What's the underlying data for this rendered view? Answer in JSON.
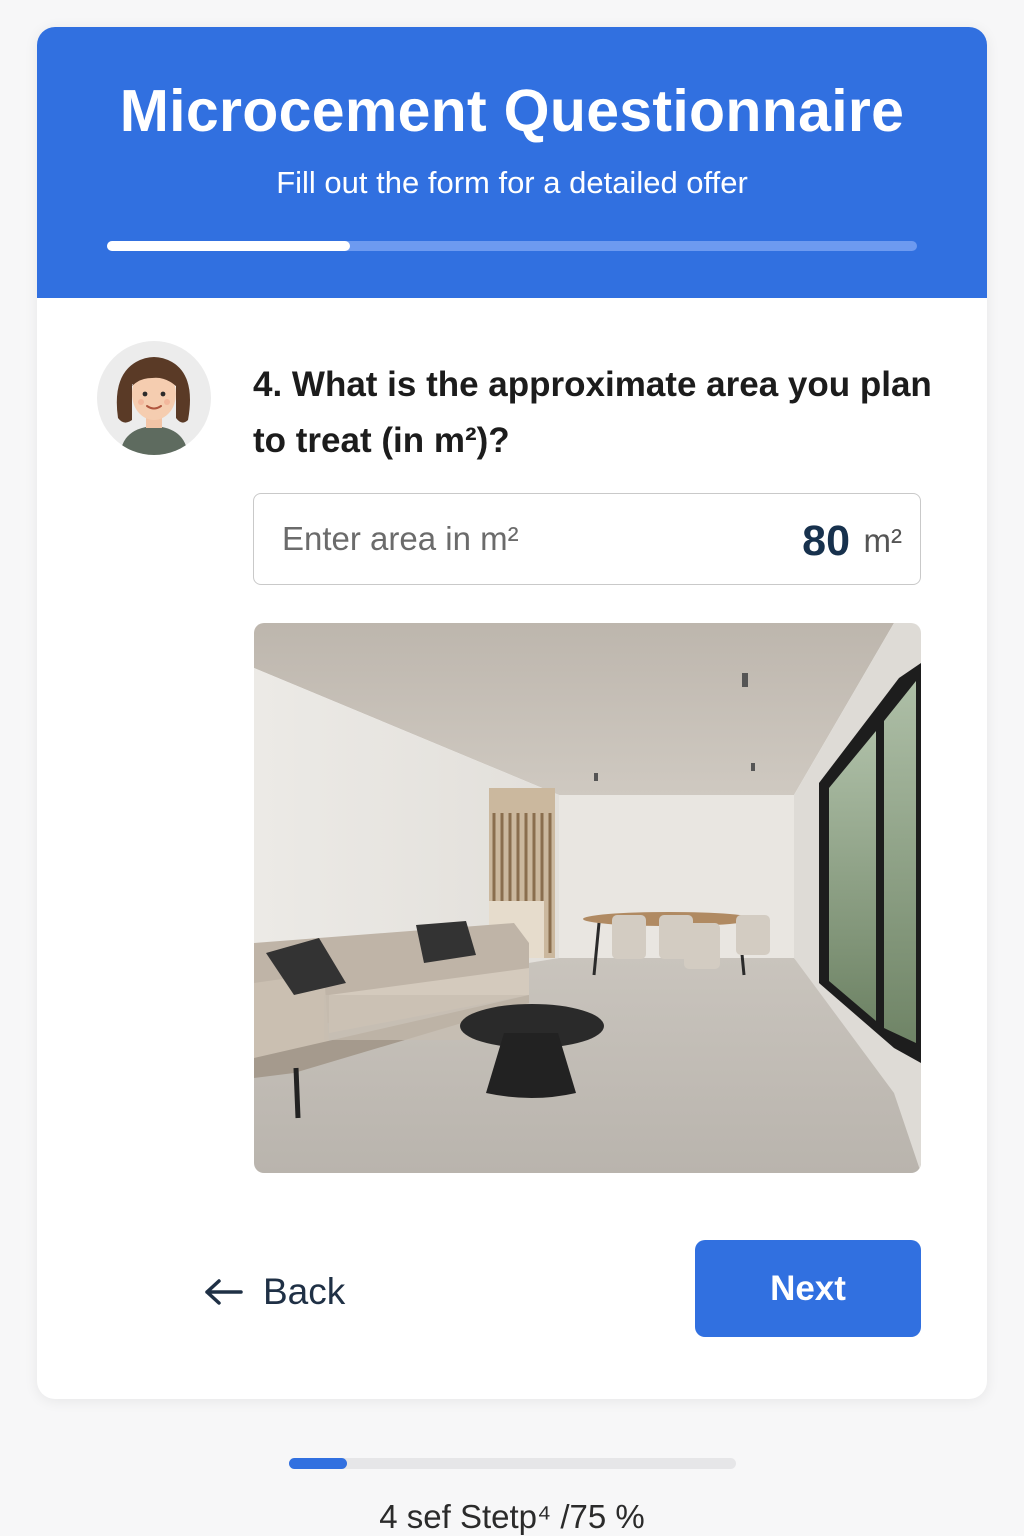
{
  "header": {
    "title": "Microcement Questionnaire",
    "subtitle": "Fill out the form for a detailed offer",
    "progress_fraction": 0.3
  },
  "question": {
    "text": "4. What is the approximate area you plan to treat (in m²)?",
    "avatar_icon": "woman-avatar-icon"
  },
  "area_input": {
    "placeholder": "Enter area in m²",
    "value": "80",
    "unit": "m²"
  },
  "image": {
    "description_icon": "living-room-photo"
  },
  "nav": {
    "back_label": "Back",
    "next_label": "Next"
  },
  "footer": {
    "progress_fraction": 0.13,
    "step_text": "4 sef  Stetp⁴  /75 %"
  },
  "colors": {
    "accent": "#3170e0",
    "text_dark": "#1c1c1c",
    "value_color": "#17314d"
  }
}
